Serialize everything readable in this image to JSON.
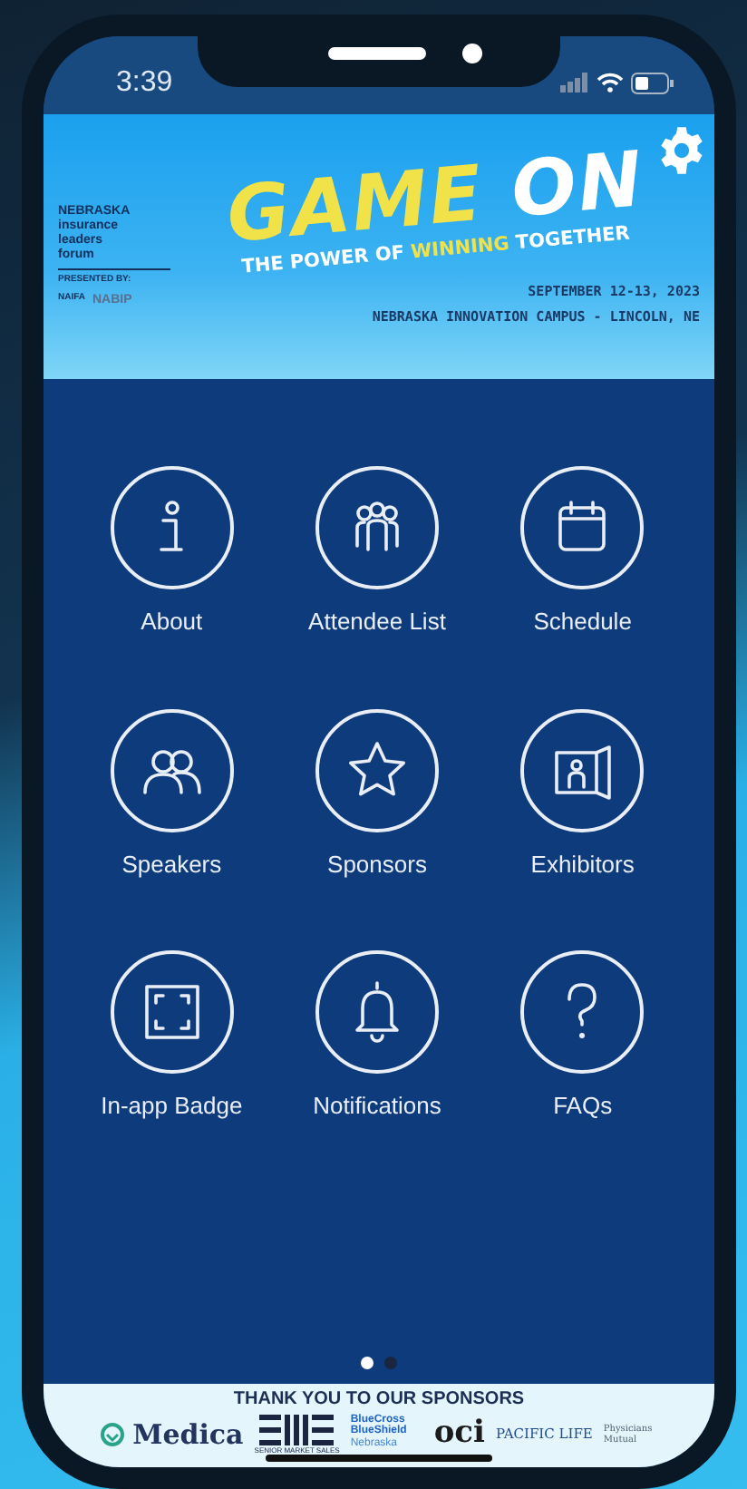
{
  "status_bar": {
    "time": "3:39"
  },
  "banner": {
    "org_lines": [
      "NEBRASKA",
      "insurance",
      "leaders",
      "forum"
    ],
    "presented_by": "PRESENTED BY:",
    "partners": [
      "NAIFA",
      "NABIP"
    ],
    "title_first": "GAME",
    "title_second": "ON",
    "tagline_start": "THE POWER OF",
    "tagline_highlight": "WINNING",
    "tagline_end": "TOGETHER",
    "date": "SEPTEMBER 12-13, 2023",
    "venue": "NEBRASKA INNOVATION CAMPUS - LINCOLN, NE"
  },
  "menu": [
    {
      "label": "About",
      "kind": "info"
    },
    {
      "label": "Attendee List",
      "kind": "people"
    },
    {
      "label": "Schedule",
      "kind": "calendar"
    },
    {
      "label": "Speakers",
      "kind": "speakers"
    },
    {
      "label": "Sponsors",
      "kind": "star"
    },
    {
      "label": "Exhibitors",
      "kind": "booth"
    },
    {
      "label": "In-app Badge",
      "kind": "badge"
    },
    {
      "label": "Notifications",
      "kind": "bell"
    },
    {
      "label": "FAQs",
      "kind": "question"
    }
  ],
  "pager": [
    {
      "selected": true
    },
    {
      "selected": false
    }
  ],
  "sponsors": {
    "heading": "THANK YOU TO OUR SPONSORS",
    "logos": [
      {
        "kind": "medica",
        "text": "Medica"
      },
      {
        "kind": "sms",
        "text": "SENIOR MARKET SALES"
      },
      {
        "kind": "bcbs",
        "text": "BlueCross BlueShield",
        "sub": "Nebraska"
      },
      {
        "kind": "oci",
        "text": "oci"
      },
      {
        "kind": "pacific",
        "text": "PACIFIC LIFE"
      },
      {
        "kind": "physicians",
        "text": "Physicians Mutual"
      }
    ]
  }
}
